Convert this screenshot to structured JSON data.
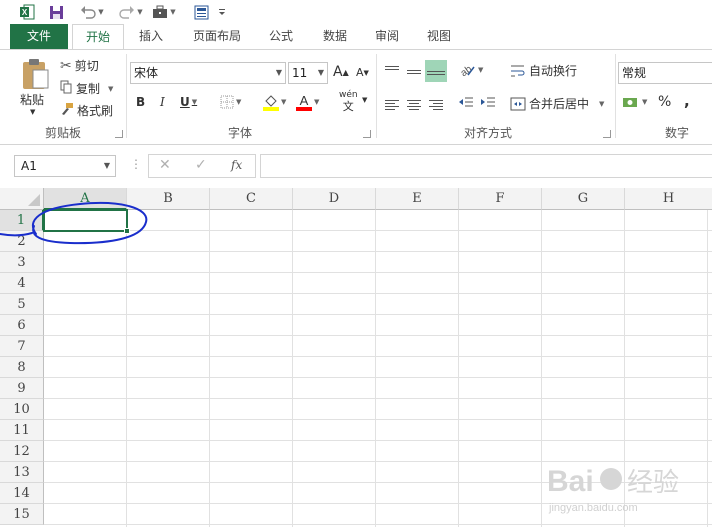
{
  "quick_access": {
    "icons": [
      "excel-logo-icon",
      "save-icon",
      "undo-icon",
      "redo-icon",
      "briefcase-icon",
      "form-icon",
      "customize-qat-icon"
    ]
  },
  "tabs": [
    {
      "label": "文件"
    },
    {
      "label": "开始"
    },
    {
      "label": "插入"
    },
    {
      "label": "页面布局"
    },
    {
      "label": "公式"
    },
    {
      "label": "数据"
    },
    {
      "label": "审阅"
    },
    {
      "label": "视图"
    }
  ],
  "ribbon": {
    "clipboard": {
      "paste": "粘贴",
      "cut": "剪切",
      "copy": "复制",
      "format_painter": "格式刷",
      "group": "剪贴板"
    },
    "font": {
      "name": "宋体",
      "size": "11",
      "bold": "B",
      "italic": "I",
      "underline": "U",
      "grow": "A",
      "shrink": "A",
      "phonetic_top": "wén",
      "phonetic_bottom": "文",
      "group": "字体"
    },
    "alignment": {
      "wrap": "自动换行",
      "merge": "合并后居中",
      "group": "对齐方式"
    },
    "number": {
      "format": "常规",
      "percent": "%",
      "comma": ",",
      "group": "数字"
    },
    "colors": {
      "accent": "#217346",
      "fill": "#ffff00",
      "font_color": "#ff0000",
      "selected_align_bg": "#9fd5b7"
    }
  },
  "formula_bar": {
    "name_box": "A1",
    "cancel": "✕",
    "enter": "✓",
    "fx": "fx",
    "content": ""
  },
  "grid": {
    "columns": [
      "A",
      "B",
      "C",
      "D",
      "E",
      "F",
      "G",
      "H"
    ],
    "rows": [
      "1",
      "2",
      "3",
      "4",
      "5",
      "6",
      "7",
      "8",
      "9",
      "10",
      "11",
      "12",
      "13",
      "14",
      "15"
    ],
    "active_cell": "A1",
    "annotation_color": "#1a2ecc"
  }
}
